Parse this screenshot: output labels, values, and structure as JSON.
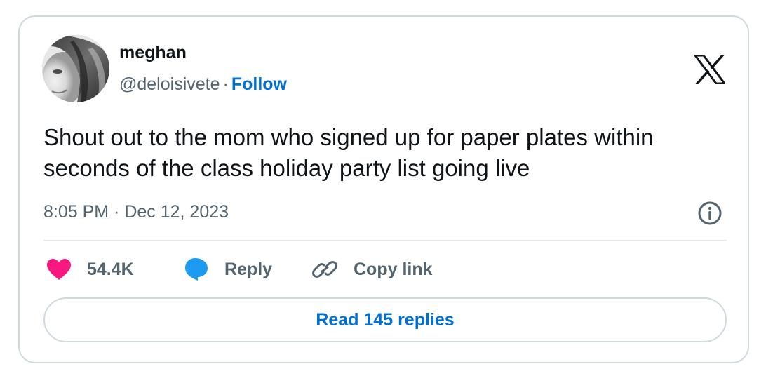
{
  "author": {
    "name": "meghan",
    "handle": "@deloisivete",
    "separator": "·",
    "follow_label": "Follow"
  },
  "tweet": {
    "text": "Shout out to the mom who signed up for paper plates within seconds of the class holiday party list going live",
    "timestamp": "8:05 PM · Dec 12, 2023"
  },
  "actions": {
    "like_count": "54.4K",
    "reply_label": "Reply",
    "copy_link_label": "Copy link"
  },
  "read_replies_label": "Read 145 replies",
  "icons": {
    "logo": "x-logo-icon",
    "info": "info-icon",
    "like": "heart-icon",
    "reply": "speech-bubble-icon",
    "copy": "link-icon"
  },
  "colors": {
    "like": "#f91880",
    "reply": "#1d9bf0",
    "link_blue": "#006fd6",
    "muted": "#536471",
    "border": "#cfd9de"
  }
}
